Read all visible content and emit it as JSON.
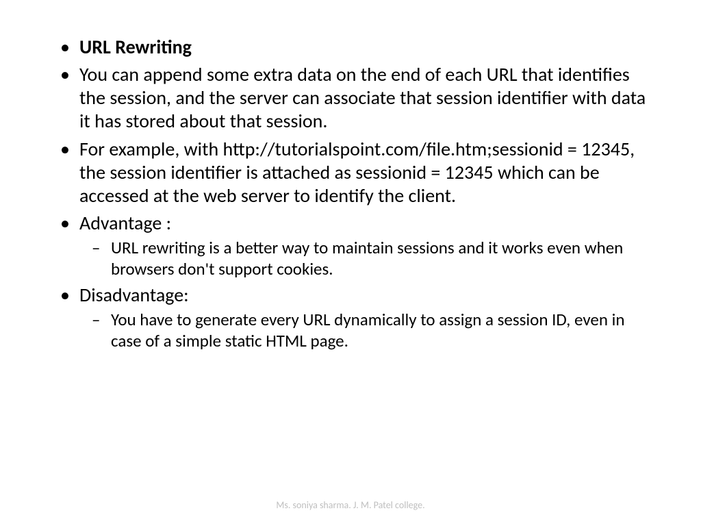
{
  "bullets": {
    "title": "URL Rewriting",
    "p1": "You can append some extra data on the end of each URL that identifies the session, and the server can associate that session identifier with data it has stored about that session.",
    "p2": "For example, with http://tutorialspoint.com/file.htm;sessionid = 12345, the session identifier is attached as sessionid = 12345 which can be accessed at the web server to identify the client.",
    "adv_label": "Advantage :",
    "adv_text": "URL rewriting is a better way to maintain sessions and it works even when browsers don't support cookies.",
    "dis_label": "Disadvantage:",
    "dis_text": "You have to generate every URL dynamically to assign a session ID, even in case of a simple static HTML page."
  },
  "footer": "Ms. soniya sharma. J. M. Patel college."
}
